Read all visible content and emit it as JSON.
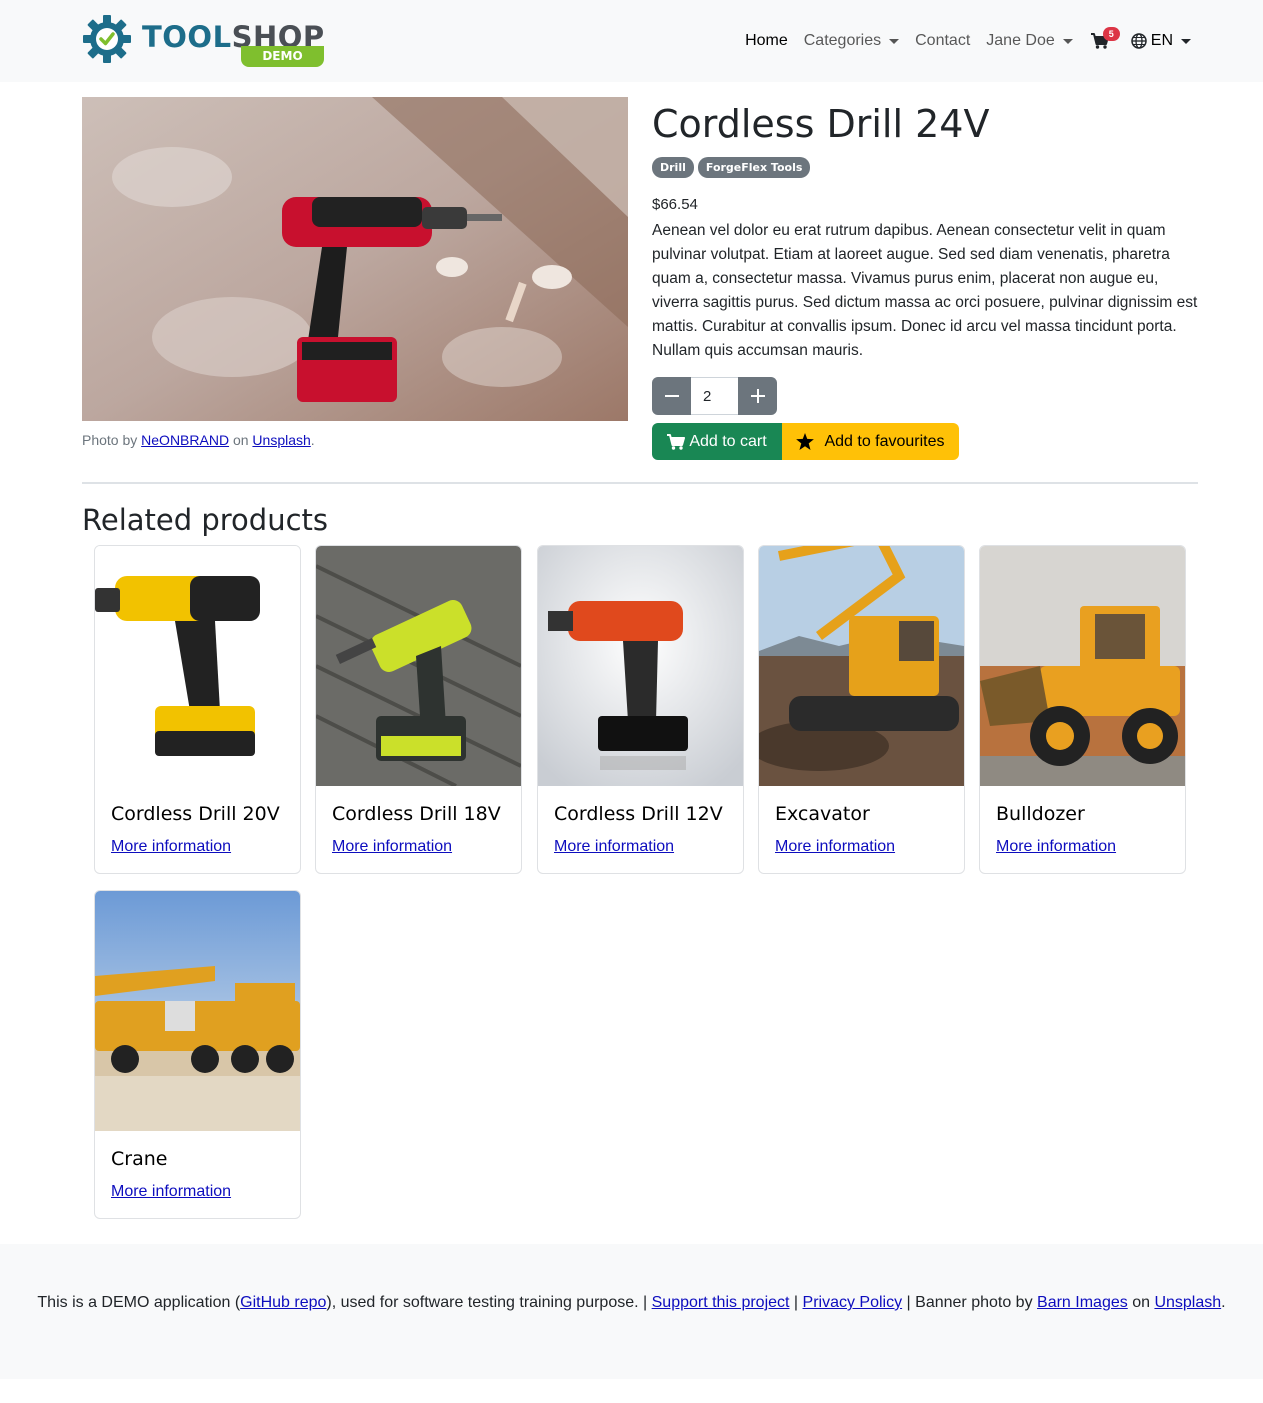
{
  "header": {
    "logo_text_1": "TOOL",
    "logo_text_2": "SHOP",
    "logo_badge": "DEMO",
    "nav": {
      "home": "Home",
      "categories": "Categories",
      "contact": "Contact",
      "user": "Jane Doe",
      "cart_count": "5",
      "language": "EN"
    }
  },
  "product": {
    "title": "Cordless Drill 24V",
    "tags": [
      "Drill",
      "ForgeFlex Tools"
    ],
    "price": "$66.54",
    "description": "Aenean vel dolor eu erat rutrum dapibus. Aenean consectetur velit in quam pulvinar volutpat. Etiam at laoreet augue. Sed sed diam venenatis, pharetra quam a, consectetur massa. Vivamus purus enim, placerat non augue eu, viverra sagittis purus. Sed dictum massa ac orci posuere, pulvinar dignissim est mattis. Curabitur at convallis ipsum. Donec id arcu vel massa tincidunt porta. Nullam quis accumsan mauris.",
    "quantity": "2",
    "add_to_cart": "Add to cart",
    "add_to_favourites": "Add to favourites",
    "photo_credit": {
      "prefix": "Photo by ",
      "author": "NeONBRAND",
      "middle": " on ",
      "source": "Unsplash",
      "suffix": "."
    }
  },
  "related": {
    "title": "Related products",
    "items": [
      {
        "name": "Cordless Drill 20V",
        "link": "More information"
      },
      {
        "name": "Cordless Drill 18V",
        "link": "More information"
      },
      {
        "name": "Cordless Drill 12V",
        "link": "More information"
      },
      {
        "name": "Excavator",
        "link": "More information"
      },
      {
        "name": "Bulldozer",
        "link": "More information"
      },
      {
        "name": "Crane",
        "link": "More information"
      }
    ]
  },
  "footer": {
    "t1": "This is a DEMO application (",
    "github": "GitHub repo",
    "t2": "), used for software testing training purpose. | ",
    "support": "Support this project",
    "t3": " | ",
    "privacy": "Privacy Policy",
    "t4": " | Banner photo by ",
    "barn": "Barn Images",
    "t5": " on ",
    "unsplash": "Unsplash",
    "t6": "."
  },
  "colors": {
    "brand_blue": "#1d6d8a",
    "brand_green": "#7fbf2e",
    "success": "#198754",
    "warning": "#ffc107",
    "secondary": "#6c757d",
    "danger": "#dc3545",
    "link": "#0d0dbe"
  },
  "icons": {
    "cart": "shopping-cart-icon",
    "language": "globe-icon",
    "favourite": "star-icon",
    "minus": "minus-icon",
    "plus": "plus-icon",
    "logo": "gear-check-icon"
  }
}
